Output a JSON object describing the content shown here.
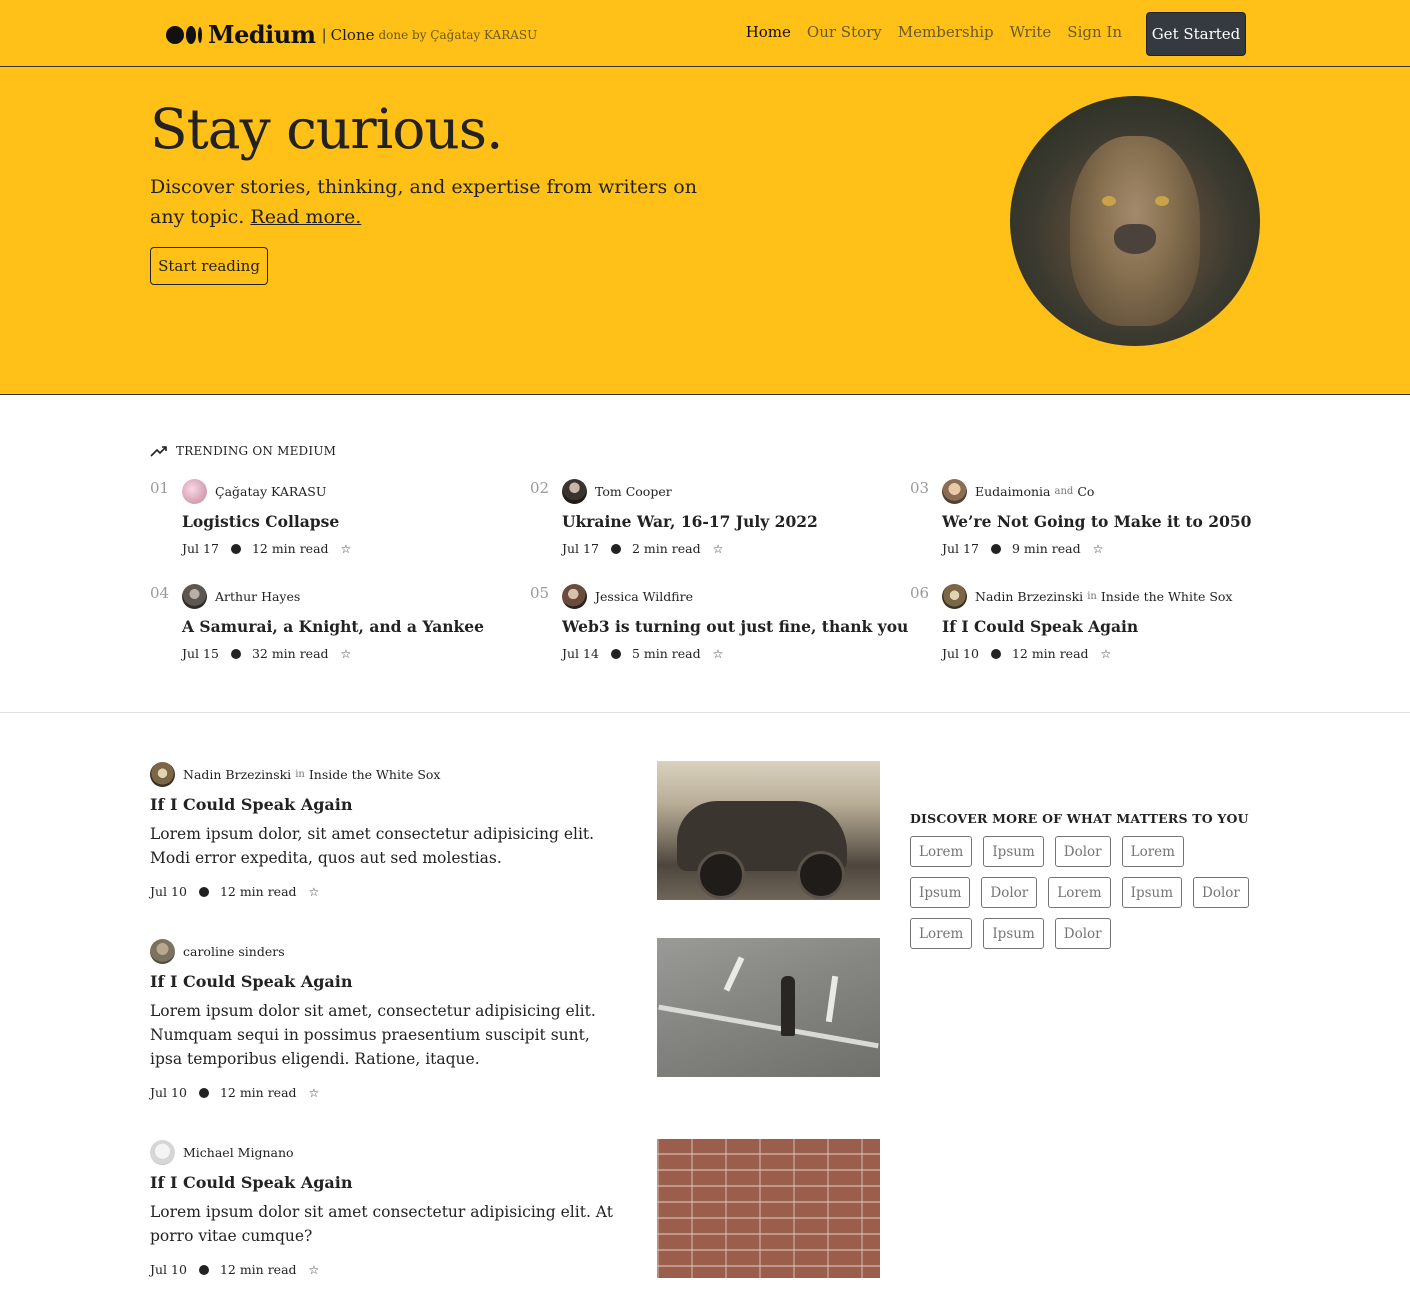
{
  "nav": {
    "brand": "Medium",
    "clone_label": "Clone",
    "byline": "done by Çağatay KARASU",
    "links": [
      "Home",
      "Our Story",
      "Membership",
      "Write",
      "Sign In"
    ],
    "cta": "Get Started"
  },
  "hero": {
    "title": "Stay curious.",
    "subtitle": "Discover stories, thinking, and expertise from writers on any topic.",
    "read_more": "Read more.",
    "button": "Start reading"
  },
  "trending": {
    "heading": "TRENDING ON MEDIUM",
    "items": [
      {
        "num": "01",
        "author": "Çağatay KARASU",
        "pub_sep": "",
        "publication": "",
        "title": "Logistics Collapse",
        "date": "Jul 17",
        "read": "12 min read"
      },
      {
        "num": "02",
        "author": "Tom Cooper",
        "pub_sep": "",
        "publication": "",
        "title": "Ukraine War, 16-17 July 2022",
        "date": "Jul 17",
        "read": "2 min read"
      },
      {
        "num": "03",
        "author": "Eudaimonia",
        "pub_sep": "and",
        "publication": "Co",
        "title": "We’re Not Going to Make it to 2050",
        "date": "Jul 17",
        "read": "9 min read"
      },
      {
        "num": "04",
        "author": "Arthur Hayes",
        "pub_sep": "",
        "publication": "",
        "title": "A Samurai, a Knight, and a Yankee",
        "date": "Jul 15",
        "read": "32 min read"
      },
      {
        "num": "05",
        "author": "Jessica Wildfire",
        "pub_sep": "",
        "publication": "",
        "title": "Web3 is turning out just fine, thank you",
        "date": "Jul 14",
        "read": "5 min read"
      },
      {
        "num": "06",
        "author": "Nadin Brzezinski",
        "pub_sep": "in",
        "publication": "Inside the White Sox",
        "title": "If I Could Speak Again",
        "date": "Jul 10",
        "read": "12 min read"
      }
    ]
  },
  "posts": [
    {
      "author": "Nadin Brzezinski",
      "pub_sep": "in",
      "publication": "Inside the White Sox",
      "title": "If I Could Speak Again",
      "body": "Lorem ipsum dolor, sit amet consectetur adipisicing elit. Modi error expedita, quos aut sed molestias.",
      "date": "Jul 10",
      "read": "12 min read"
    },
    {
      "author": "caroline sinders",
      "pub_sep": "",
      "publication": "",
      "title": "If I Could Speak Again",
      "body": "Lorem ipsum dolor sit amet, consectetur adipisicing elit. Numquam sequi in possimus praesentium suscipit sunt, ipsa temporibus eligendi. Ratione, itaque.",
      "date": "Jul 10",
      "read": "12 min read"
    },
    {
      "author": "Michael Mignano",
      "pub_sep": "",
      "publication": "",
      "title": "If I Could Speak Again",
      "body": "Lorem ipsum dolor sit amet consectetur adipisicing elit. At porro vitae cumque?",
      "date": "Jul 10",
      "read": "12 min read"
    }
  ],
  "discover": {
    "heading": "DISCOVER MORE OF WHAT MATTERS TO YOU",
    "tags": [
      "Lorem",
      "Ipsum",
      "Dolor",
      "Lorem",
      "Ipsum",
      "Dolor",
      "Lorem",
      "Ipsum",
      "Dolor",
      "Lorem",
      "Ipsum",
      "Dolor"
    ]
  },
  "colors": {
    "brand_yellow": "#ffc017",
    "dark_button": "#343a40"
  }
}
